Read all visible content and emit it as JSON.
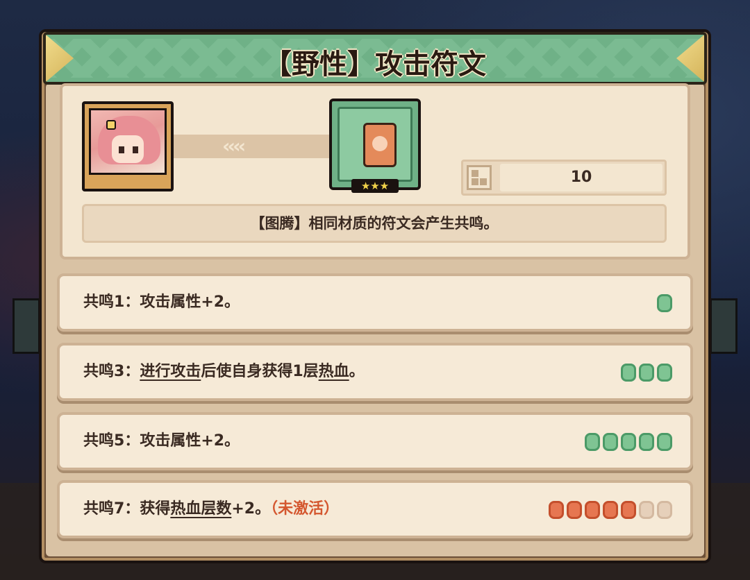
{
  "title": "【野性】攻击符文",
  "rune": {
    "stars": "★★★",
    "level_value": "10"
  },
  "description": "【图腾】相同材质的符文会产生共鸣。",
  "link_chevrons": "‹‹‹‹",
  "resonances": [
    {
      "label": "共鸣1：",
      "parts": [
        {
          "text": "攻击属性+2。",
          "u": false
        }
      ],
      "status": "",
      "pips": {
        "total": 1,
        "filled": 1,
        "color": "#7fc493"
      }
    },
    {
      "label": "共鸣3：",
      "parts": [
        {
          "text": "进行攻击",
          "u": true
        },
        {
          "text": "后使自身获得1层",
          "u": false
        },
        {
          "text": "热血",
          "u": true
        },
        {
          "text": "。",
          "u": false
        }
      ],
      "status": "",
      "pips": {
        "total": 3,
        "filled": 3,
        "color": "#7fc493"
      }
    },
    {
      "label": "共鸣5：",
      "parts": [
        {
          "text": "攻击属性+2。",
          "u": false
        }
      ],
      "status": "",
      "pips": {
        "total": 5,
        "filled": 5,
        "color": "#7fc493"
      }
    },
    {
      "label": "共鸣7：",
      "parts": [
        {
          "text": "获得",
          "u": false
        },
        {
          "text": "热血层数",
          "u": true
        },
        {
          "text": "+2。",
          "u": false
        }
      ],
      "status": "（未激活）",
      "pips": {
        "total": 7,
        "filled": 5,
        "color": "#e67651"
      }
    }
  ],
  "colors": {
    "banner_green": "#6fb187",
    "panel_bg": "#f6ead7",
    "text_dark": "#3a2a22",
    "inactive_red": "#d4572f",
    "pip_green": "#7fc493",
    "pip_orange": "#e67651"
  }
}
